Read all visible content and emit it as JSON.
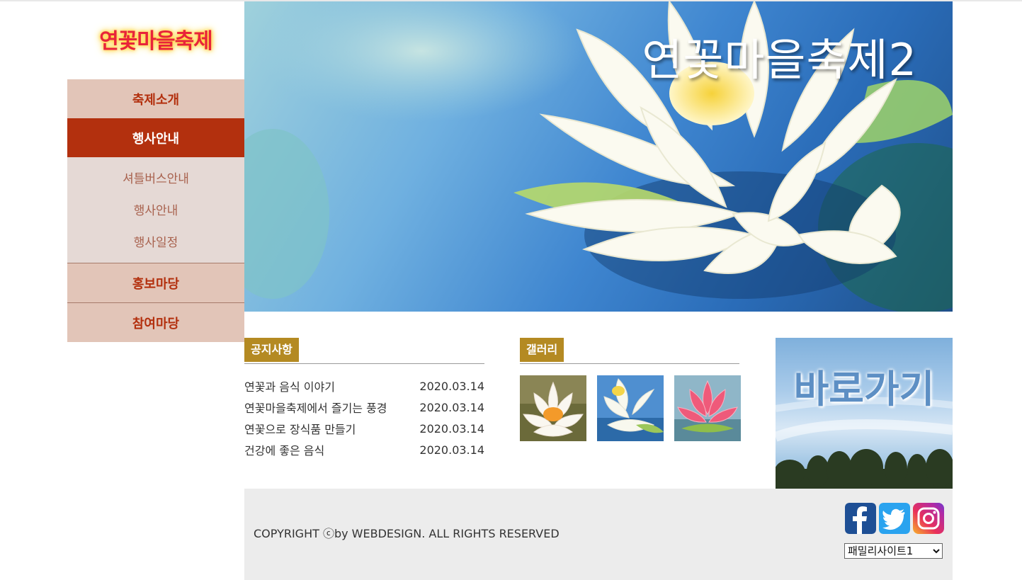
{
  "logo": "연꽃마을축제",
  "nav": {
    "items": [
      {
        "label": "축제소개"
      },
      {
        "label": "행사안내"
      },
      {
        "label": "홍보마당"
      },
      {
        "label": "참여마당"
      }
    ],
    "submenu": [
      {
        "label": "셔틀버스안내"
      },
      {
        "label": "행사안내"
      },
      {
        "label": "행사일정"
      }
    ]
  },
  "hero": {
    "title": "연꽃마을축제2"
  },
  "notice": {
    "title": "공지사항",
    "items": [
      {
        "title": "연꽃과 음식 이야기",
        "date": "2020.03.14"
      },
      {
        "title": "연꽃마을축제에서 즐기는 풍경",
        "date": "2020.03.14"
      },
      {
        "title": "연꽃으로 장식품 만들기",
        "date": "2020.03.14"
      },
      {
        "title": "건강에 좋은 음식",
        "date": "2020.03.14"
      }
    ]
  },
  "gallery": {
    "title": "갤러리"
  },
  "shortcut": {
    "label": "바로가기"
  },
  "footer": {
    "copyright": "COPYRIGHT ⓒby WEBDESIGN. ALL RIGHTS RESERVED",
    "family_site": "패밀리사이트1"
  },
  "colors": {
    "accent": "#b3300e",
    "nav_bg": "#e2c5b8",
    "sub_bg": "#e5d9d5",
    "section_tag": "#b48a22",
    "footer_bg": "#ececec"
  },
  "icons": [
    "facebook-icon",
    "twitter-icon",
    "instagram-icon",
    "chevron-down-icon"
  ]
}
